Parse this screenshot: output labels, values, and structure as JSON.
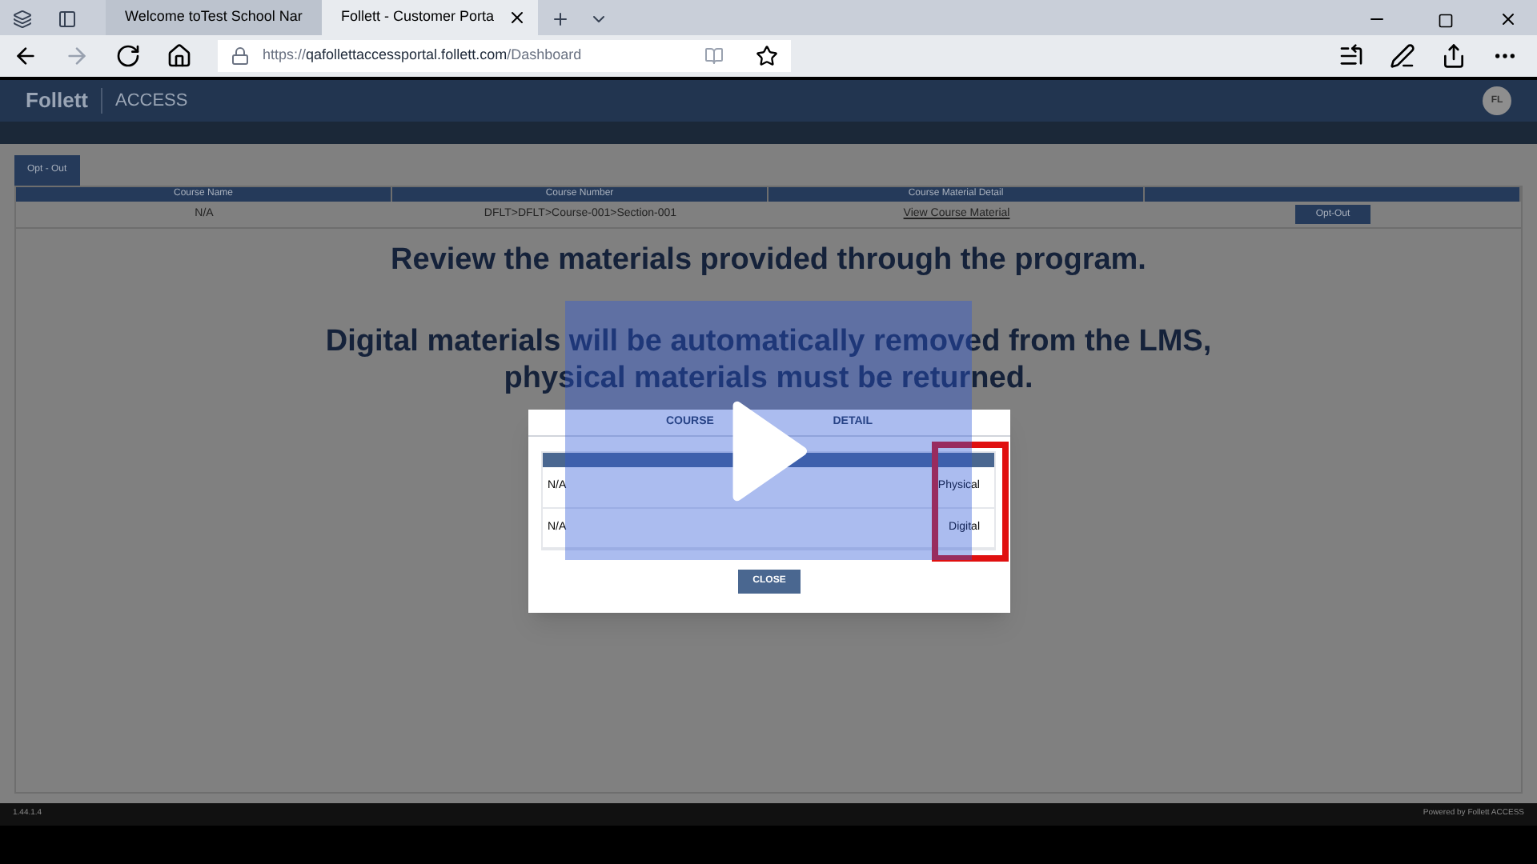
{
  "browser": {
    "tabs": [
      {
        "title": "Welcome toTest School Nar",
        "selected": false
      },
      {
        "title": "Follett - Customer Porta",
        "selected": true
      }
    ],
    "url_prefix": "https://",
    "url_host": "qafollettaccessportal.follett.com",
    "url_path": "/Dashboard"
  },
  "app_header": {
    "brand": "Follett",
    "product": "ACCESS",
    "avatar": "FL"
  },
  "opt_out_tab": "Opt - Out",
  "table": {
    "columns": [
      "Course Name",
      "Course Number",
      "Course Material Detail",
      ""
    ],
    "rows": [
      {
        "course_name": "N/A",
        "course_number": "DFLT>DFLT>Course-001>Section-001",
        "detail_link": "View Course Material",
        "action": "Opt-Out"
      }
    ]
  },
  "notice": {
    "line_1": "Review the materials provided through the program.",
    "line_2": "Digital materials will be automatically removed from the LMS, physical materials must be returned."
  },
  "modal": {
    "title_left": "COURSE",
    "title_right": "DETAIL",
    "rows": [
      {
        "course_name": "N/A",
        "type": "Physical"
      },
      {
        "course_name": "N/A",
        "type": "Digital"
      }
    ],
    "close": "CLOSE"
  },
  "footer": {
    "version": "1.44.1.4",
    "powered": "Powered by Follett ACCESS"
  }
}
